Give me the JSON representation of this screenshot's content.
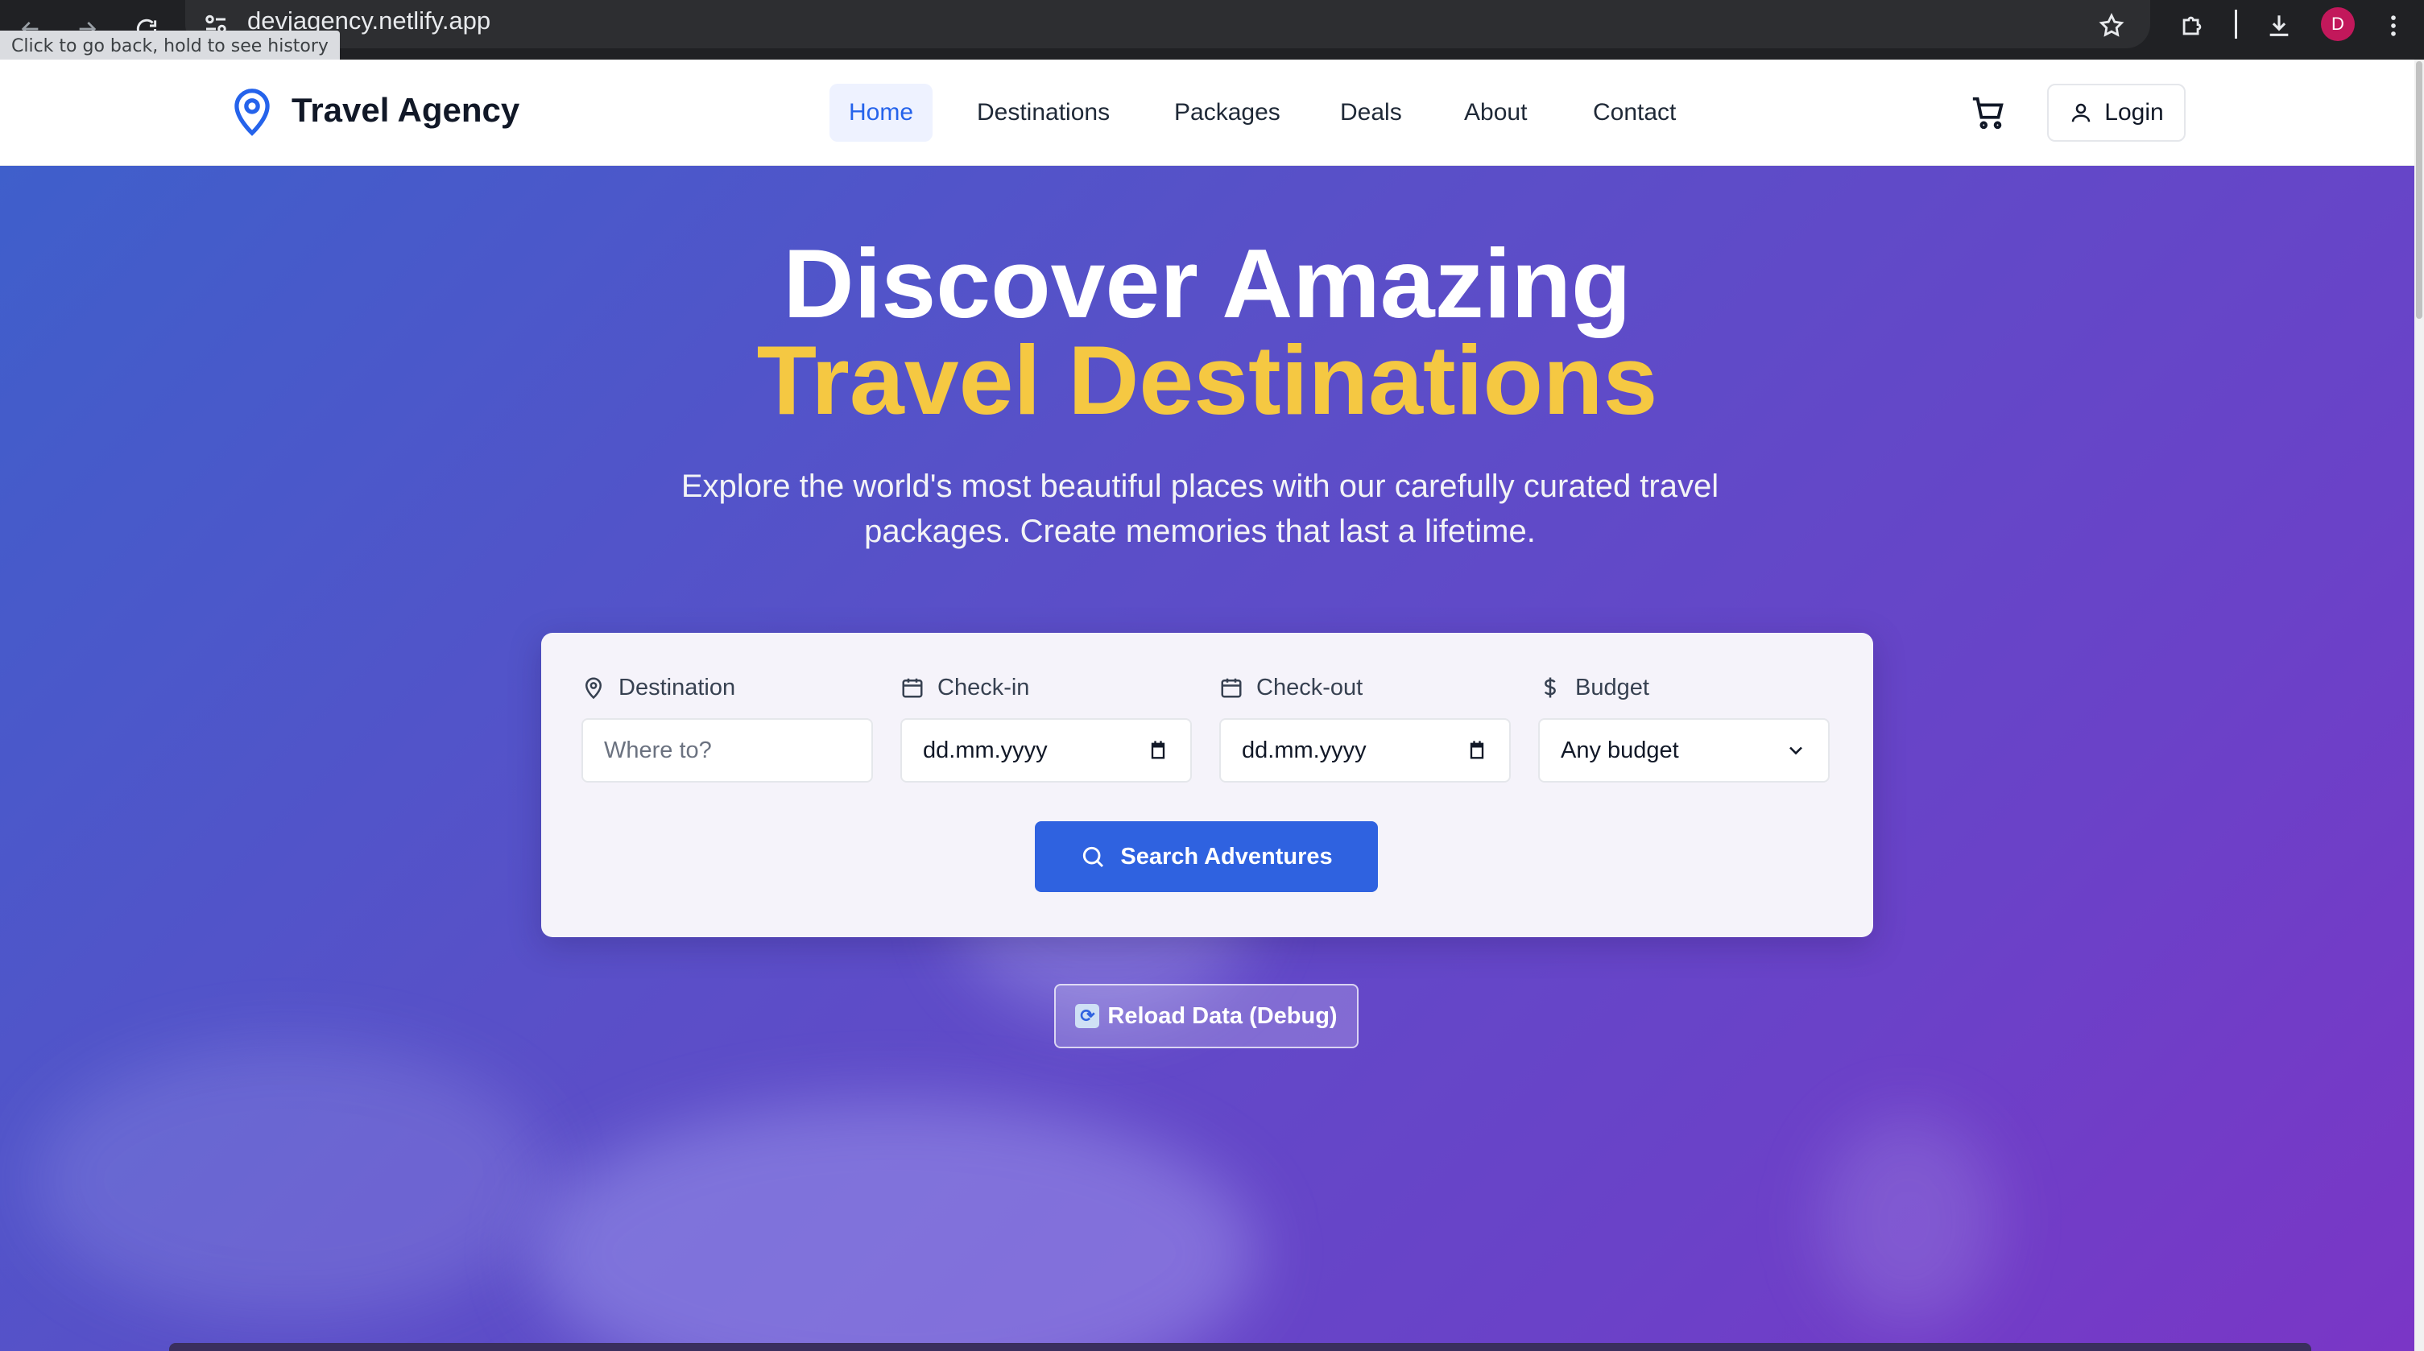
{
  "browser": {
    "url": "devjagency.netlify.app",
    "tooltip": "Click to go back, hold to see history",
    "profile_initial": "D"
  },
  "header": {
    "brand": "Travel Agency",
    "nav": [
      {
        "label": "Home",
        "active": true
      },
      {
        "label": "Destinations",
        "active": false
      },
      {
        "label": "Packages",
        "active": false
      },
      {
        "label": "Deals",
        "active": false
      },
      {
        "label": "About",
        "active": false
      },
      {
        "label": "Contact",
        "active": false
      }
    ],
    "login_label": "Login"
  },
  "hero": {
    "title_line1": "Discover Amazing",
    "title_line2": "Travel Destinations",
    "subtitle": "Explore the world's most beautiful places with our carefully curated travel packages. Create memories that last a lifetime."
  },
  "search": {
    "destination": {
      "label": "Destination",
      "placeholder": "Where to?"
    },
    "checkin": {
      "label": "Check-in",
      "value": "dd.mm.yyyy"
    },
    "checkout": {
      "label": "Check-out",
      "value": "dd.mm.yyyy"
    },
    "budget": {
      "label": "Budget",
      "value": "Any budget"
    },
    "button_label": "Search Adventures"
  },
  "debug": {
    "reload_label": "Reload Data (Debug)"
  },
  "colors": {
    "accent": "#2563eb",
    "title_highlight": "#f5c842",
    "hero_gradient_start": "#3f5fcb",
    "hero_gradient_end": "#7a36c6"
  }
}
